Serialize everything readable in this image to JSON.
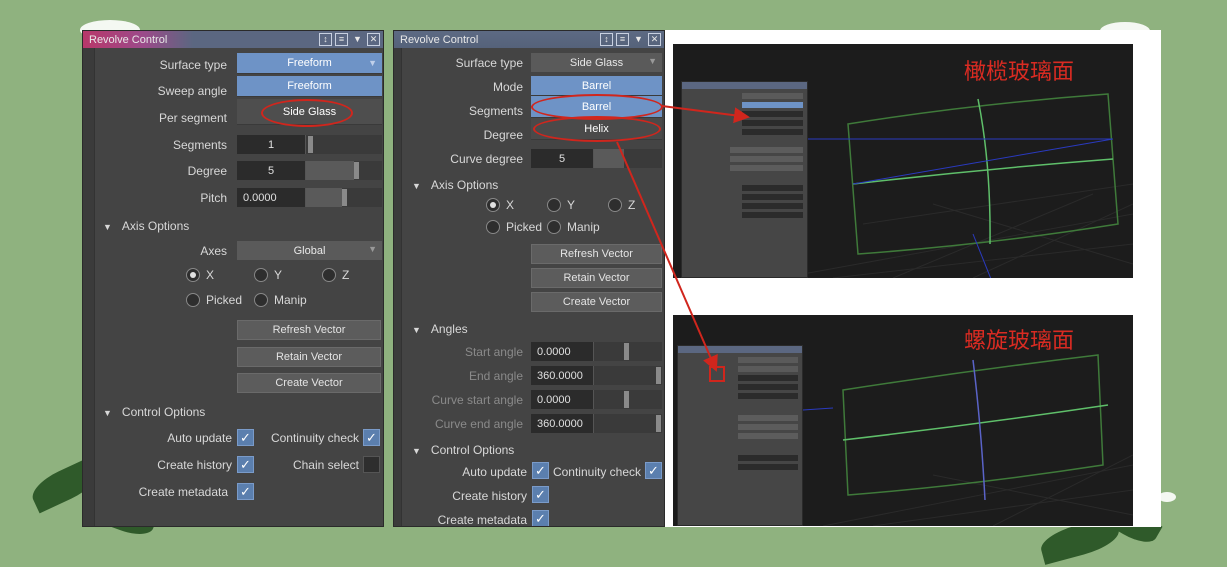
{
  "colors": {
    "accent": "#6e93c6",
    "annotation": "#d0261d",
    "background": "#8fb27f"
  },
  "panel1": {
    "title": "Revolve Control",
    "labels": {
      "surface_type": "Surface type",
      "sweep_angle": "Sweep angle",
      "per_segment": "Per segment",
      "segments": "Segments",
      "degree": "Degree",
      "pitch": "Pitch",
      "axes": "Axes"
    },
    "dropdown_options": [
      "Freeform",
      "Freeform",
      "Side Glass"
    ],
    "values": {
      "segments": "1",
      "degree": "5",
      "pitch": "0.0000",
      "axes": "Global"
    },
    "sections": {
      "axis": "Axis Options",
      "control": "Control Options"
    },
    "radios": {
      "x": "X",
      "y": "Y",
      "z": "Z",
      "picked": "Picked",
      "manip": "Manip"
    },
    "buttons": {
      "refresh": "Refresh Vector",
      "retain": "Retain Vector",
      "create": "Create Vector"
    },
    "checks": {
      "auto_update": "Auto update",
      "continuity": "Continuity check",
      "create_history": "Create history",
      "chain_select": "Chain select",
      "create_metadata": "Create metadata"
    }
  },
  "panel2": {
    "title": "Revolve Control",
    "labels": {
      "surface_type": "Surface type",
      "mode": "Mode",
      "segments": "Segments",
      "degree": "Degree",
      "curve_degree": "Curve degree",
      "start_angle": "Start angle",
      "end_angle": "End angle",
      "curve_start": "Curve start angle",
      "curve_end": "Curve end angle"
    },
    "surface_value": "Side Glass",
    "mode_options": [
      "Barrel",
      "Barrel",
      "Helix"
    ],
    "values": {
      "curve_degree": "5",
      "start_angle": "0.0000",
      "end_angle": "360.0000",
      "curve_start": "0.0000",
      "curve_end": "360.0000"
    },
    "sections": {
      "axis": "Axis Options",
      "angles": "Angles",
      "control": "Control Options"
    },
    "radios": {
      "x": "X",
      "y": "Y",
      "z": "Z",
      "picked": "Picked",
      "manip": "Manip"
    },
    "buttons": {
      "refresh": "Refresh Vector",
      "retain": "Retain Vector",
      "create": "Create Vector"
    },
    "checks": {
      "auto_update": "Auto update",
      "continuity": "Continuity check",
      "create_history": "Create history",
      "create_metadata": "Create metadata"
    }
  },
  "viewports": {
    "top_caption": "橄榄玻璃面",
    "bottom_caption": "螺旋玻璃面"
  },
  "icons": [
    "expand-icon",
    "list-icon",
    "collapse-icon",
    "close-icon",
    "dropdown-arrow-icon",
    "checkmark-icon"
  ]
}
